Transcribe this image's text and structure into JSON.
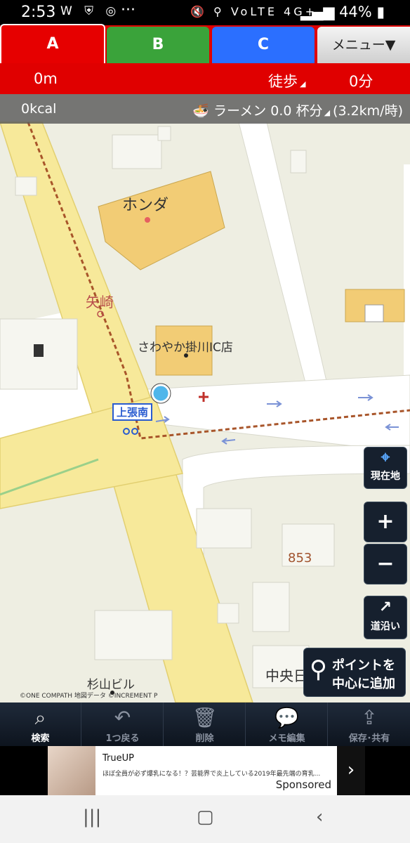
{
  "status": {
    "time": "2:53",
    "icons_left": "W ⛨ ◎",
    "dots": "···",
    "sys_icons": "🔇 ⚲ VoLTE 4G+",
    "battery": "44%"
  },
  "tabs": {
    "a": "A",
    "b": "B",
    "c": "C",
    "menu": "メニュー▼"
  },
  "info": {
    "distance": "0m",
    "mode": "徒歩",
    "time": "0分"
  },
  "calorie": {
    "kcal": "0kcal",
    "ramen": "ラーメン 0.0 杯分",
    "speed": "(3.2km/時)"
  },
  "map": {
    "labels": {
      "honda": "ホンダ",
      "yazaki": "矢崎",
      "sawayaka": "さわやか掛川IC店",
      "kamiharaminami": "上張南",
      "num853": "853",
      "sugiyama": "杉山ビル",
      "chuo": "中央日"
    },
    "copyright": "©ONE COMPATH 地図データ ©INCREMENT P"
  },
  "controls": {
    "current_location": "現在地",
    "zoom_in": "+",
    "zoom_out": "−",
    "along_road": "道沿い",
    "add_point_line1": "ポイントを",
    "add_point_line2": "中心に追加"
  },
  "toolbar": {
    "search": "検索",
    "back": "1つ戻る",
    "delete": "削除",
    "memo": "メモ編集",
    "save": "保存･共有"
  },
  "ad": {
    "title": "TrueUP",
    "text": "ほぼ全員が必ず爆乳になる！？芸能界で炎上している2019年最先端の育乳...",
    "sponsored": "Sponsored"
  },
  "colors": {
    "red": "#e00000",
    "green": "#3aa33a",
    "blue": "#2b6fff",
    "road": "#f7e99a",
    "map_bg": "#eeeee2"
  }
}
